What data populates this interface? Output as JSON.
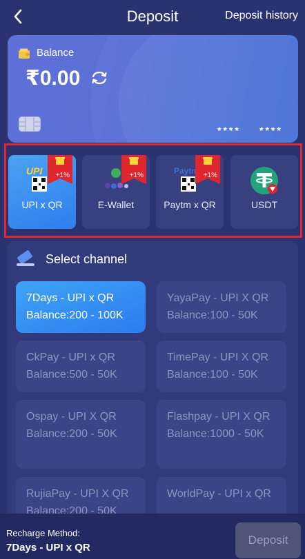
{
  "header": {
    "title": "Deposit",
    "history_label": "Deposit history",
    "back_icon": "chevron-left-icon"
  },
  "balance_card": {
    "label": "Balance",
    "amount": "₹0.00",
    "mask_1": "****",
    "mask_2": "****",
    "icons": [
      "wallet-icon",
      "refresh-icon",
      "card-chip-icon"
    ]
  },
  "payment_methods": [
    {
      "label": "UPI x QR",
      "badge": "+1%",
      "selected": true,
      "icon": "upi-qr-logo"
    },
    {
      "label": "E-Wallet",
      "badge": "+1%",
      "selected": false,
      "icon": "e-wallet-logo"
    },
    {
      "label": "Paytm x QR",
      "badge": "+1%",
      "selected": false,
      "icon": "paytm-qr-logo"
    },
    {
      "label": "USDT",
      "badge": "",
      "selected": false,
      "icon": "tether-logo"
    }
  ],
  "channels": {
    "title": "Select channel",
    "items": [
      {
        "name": "7Days - UPI x QR",
        "balance": "Balance:200 - 100K",
        "selected": true
      },
      {
        "name": "YayaPay - UPI X QR",
        "balance": "Balance:100 - 50K",
        "selected": false
      },
      {
        "name": "CkPay - UPI x QR",
        "balance": "Balance:500 - 50K",
        "selected": false
      },
      {
        "name": "TimePay - UPI X QR",
        "balance": "Balance:100 - 50K",
        "selected": false
      },
      {
        "name": "Ospay - UPI X QR",
        "balance": "Balance:200 - 50K",
        "selected": false
      },
      {
        "name": "Flashpay - UPI X QR",
        "balance": "Balance:1000 - 50K",
        "selected": false
      },
      {
        "name": "RujiaPay - UPI X QR",
        "balance": "Balance:200 - 50K",
        "selected": false
      },
      {
        "name": "WorldPay - UPI x QR",
        "balance": "",
        "selected": false
      }
    ]
  },
  "footer": {
    "method_caption": "Recharge Method:",
    "method_value": "7Days - UPI x QR",
    "deposit_label": "Deposit"
  },
  "colors": {
    "background": "#2b3270",
    "accent_blue": "#2f7ef0",
    "badge_red": "#e0262f",
    "highlight_red": "#e0262f"
  }
}
